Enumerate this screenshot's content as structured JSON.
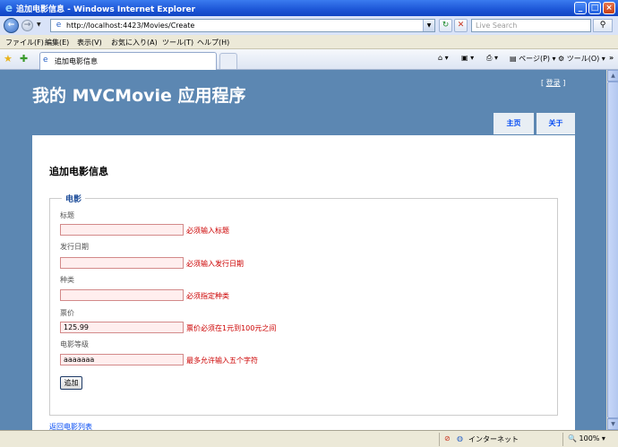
{
  "window": {
    "title": "追加电影信息 - Windows Internet Explorer",
    "minimize": "_",
    "maximize": "□",
    "close": "×"
  },
  "browser": {
    "url": "http://localhost:4423/Movies/Create",
    "search_placeholder": "Live Search",
    "menu": [
      "ファイル(F)",
      "編集(E)",
      "表示(V)",
      "お気に入り(A)",
      "ツール(T)",
      "ヘルプ(H)"
    ],
    "tab_label": "追加电影信息",
    "commands": {
      "page": "ページ(P)",
      "tools": "ツール(O)"
    },
    "status": {
      "zone": "インターネット",
      "zoom": "100%"
    }
  },
  "site": {
    "title": "我的 MVCMovie 应用程序",
    "login_prefix": "[ ",
    "login_link": "登录",
    "login_suffix": " ]",
    "nav": [
      "主页",
      "关于"
    ]
  },
  "page": {
    "heading": "追加电影信息",
    "legend": "电影",
    "fields": [
      {
        "label": "标题",
        "value": "",
        "error": "必须输入标题"
      },
      {
        "label": "发行日期",
        "value": "",
        "error": "必须输入发行日期"
      },
      {
        "label": "种类",
        "value": "",
        "error": "必须指定种类"
      },
      {
        "label": "票价",
        "value": "125.99",
        "error": "票价必须在1元到100元之间"
      },
      {
        "label": "电影等级",
        "value": "aaaaaaa",
        "error": "最多允许输入五个字符"
      }
    ],
    "submit_label": "追加",
    "back_link": "返回电影列表"
  }
}
